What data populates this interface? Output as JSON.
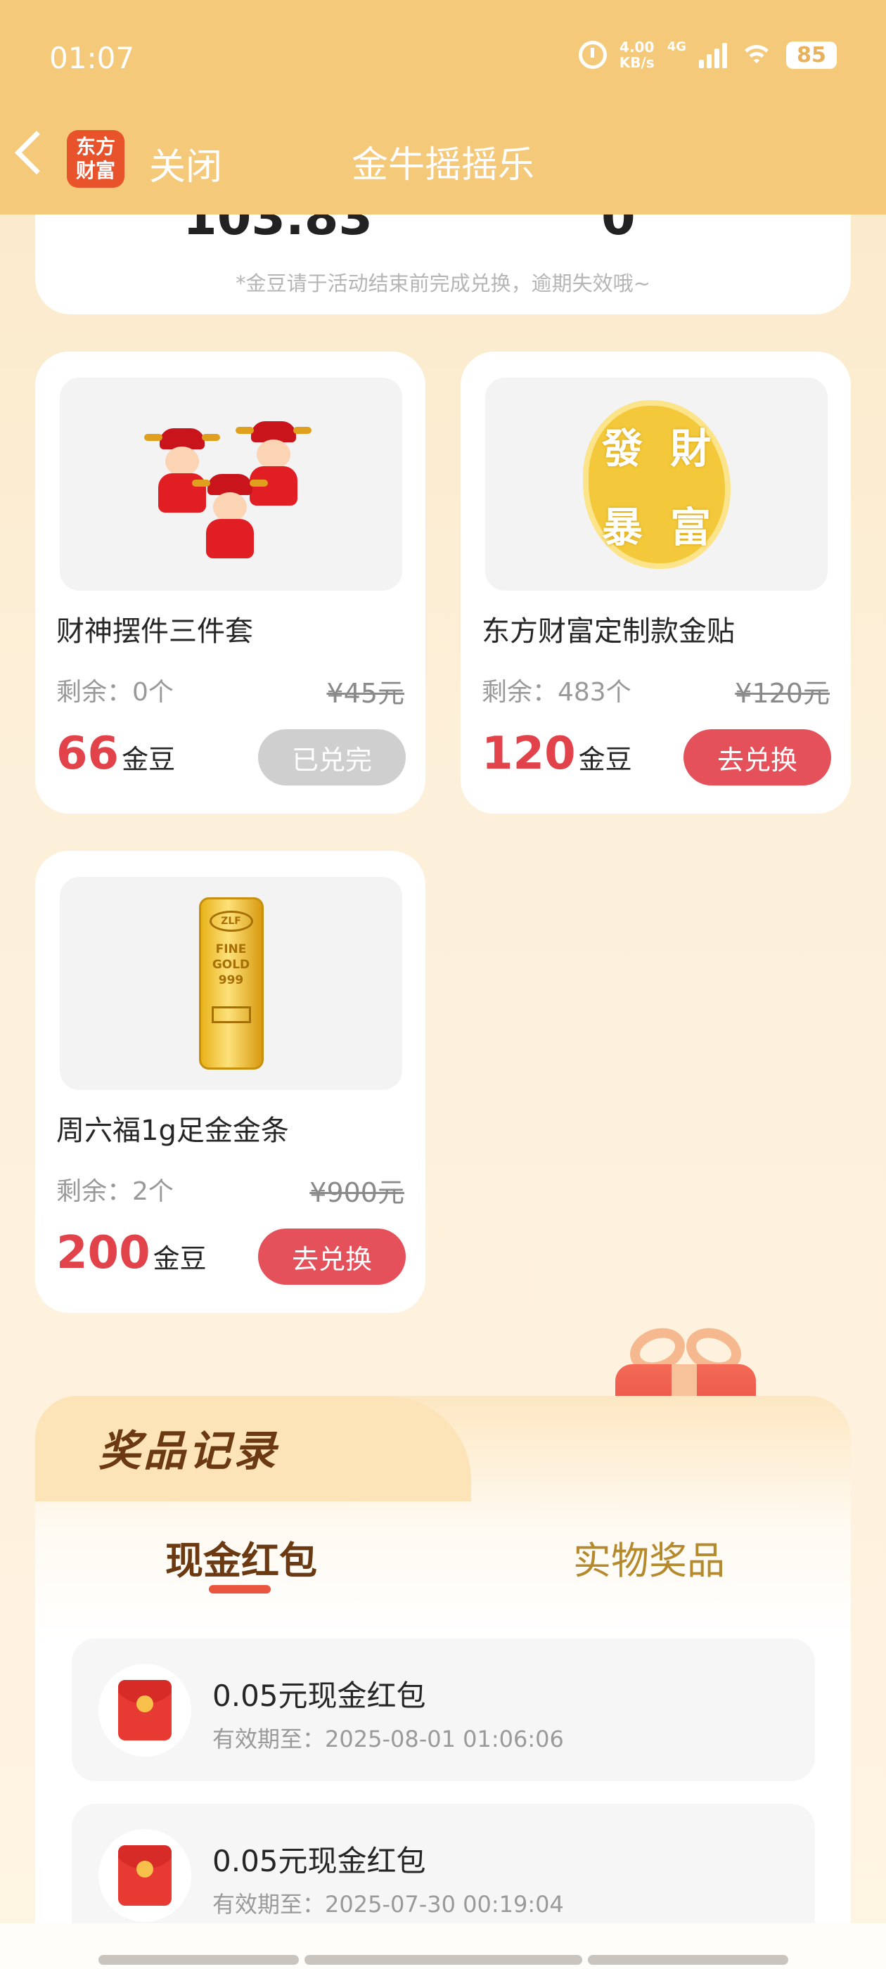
{
  "status_bar": {
    "time": "01:07",
    "net_speed_value": "4.00",
    "net_speed_unit": "KB/s",
    "network_type": "4G",
    "battery": "85"
  },
  "header": {
    "brand_logo_text": "东方财富",
    "close_label": "关闭",
    "title": "金牛摇摇乐"
  },
  "summary": {
    "value_left": "103.83",
    "value_right": "0",
    "note": "*金豆请于活动结束前完成兑换，逾期失效哦~"
  },
  "products": [
    {
      "name": "财神摆件三件套",
      "stock": "剩余：0个",
      "original_price": "¥45元",
      "price": "66",
      "unit": "金豆",
      "button": "已兑完",
      "available": false
    },
    {
      "name": "东方财富定制款金贴",
      "stock": "剩余：483个",
      "original_price": "¥120元",
      "price": "120",
      "unit": "金豆",
      "button": "去兑换",
      "available": true,
      "sticker_chars": [
        "發",
        "財",
        "暴",
        "富"
      ]
    },
    {
      "name": "周六福1g足金金条",
      "stock": "剩余：2个",
      "original_price": "¥900元",
      "price": "200",
      "unit": "金豆",
      "button": "去兑换",
      "available": true,
      "bar_text": [
        "ZLF",
        "FINE",
        "GOLD",
        "999"
      ]
    }
  ],
  "records": {
    "title": "奖品记录",
    "tabs": [
      {
        "label": "现金红包",
        "active": true
      },
      {
        "label": "实物奖品",
        "active": false
      }
    ],
    "items": [
      {
        "title": "0.05元现金红包",
        "expiry": "有效期至：2025-08-01 01:06:06"
      },
      {
        "title": "0.05元现金红包",
        "expiry": "有效期至：2025-07-30 00:19:04"
      }
    ]
  },
  "colors": {
    "header_bg": "#f5c97a",
    "accent_red": "#e2424a",
    "button_red": "#e5515a",
    "disabled_gray": "#cfcfcf",
    "records_brown": "#6b3a12"
  }
}
